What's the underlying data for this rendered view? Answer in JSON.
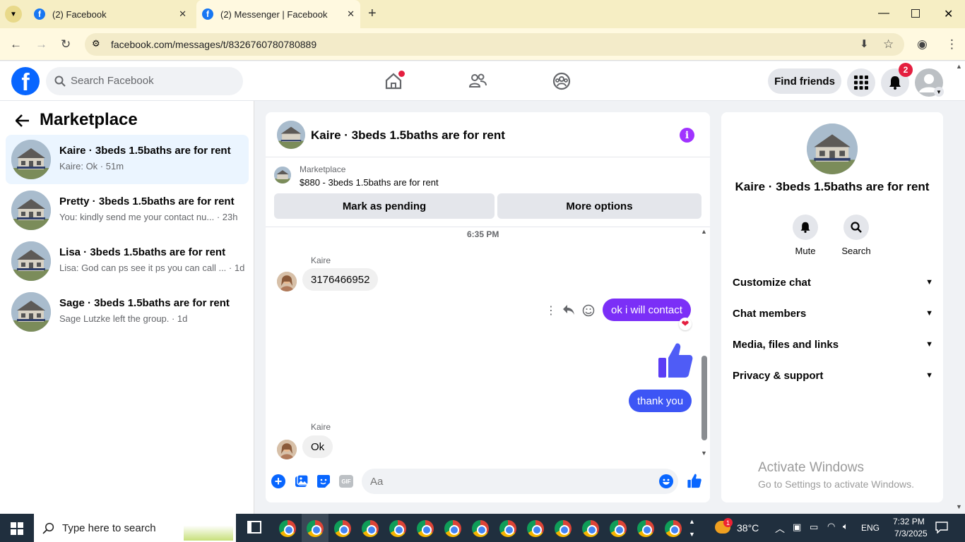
{
  "browser": {
    "tabs": [
      {
        "title": "(2) Facebook"
      },
      {
        "title": "(2) Messenger | Facebook"
      }
    ],
    "url": "facebook.com/messages/t/8326760780780889"
  },
  "fb": {
    "search_placeholder": "Search Facebook",
    "find_friends": "Find friends",
    "notif_count": "2"
  },
  "sidebar": {
    "title": "Marketplace",
    "conversations": [
      {
        "title": "Kaire · 3beds 1.5baths are for rent",
        "snippet": "Kaire: Ok · 51m"
      },
      {
        "title": "Pretty · 3beds 1.5baths are for rent",
        "snippet": "You: kindly send me your contact nu... · 23h"
      },
      {
        "title": "Lisa · 3beds 1.5baths are for rent",
        "snippet": "Lisa: God can ps see it ps you can call ... · 1d"
      },
      {
        "title": "Sage · 3beds 1.5baths are for rent",
        "snippet": "Sage Lutzke left the group. · 1d"
      }
    ]
  },
  "chat": {
    "title": "Kaire · 3beds 1.5baths are for rent",
    "marketplace_label": "Marketplace",
    "listing": "$880 - 3beds 1.5baths are for rent",
    "mark_pending": "Mark as pending",
    "more_options": "More options",
    "timestamp": "6:35 PM",
    "messages": [
      {
        "sender": "Kaire",
        "text": "3176466952"
      },
      {
        "sender": "",
        "text": "ok i will contact"
      },
      {
        "sender": "",
        "text": "thank you"
      },
      {
        "sender": "Kaire",
        "text": "Ok"
      }
    ],
    "input_placeholder": "Aa",
    "accent": "#7b2ff7"
  },
  "right": {
    "title": "Kaire · 3beds 1.5baths are for rent",
    "mute": "Mute",
    "search": "Search",
    "sections": [
      "Customize chat",
      "Chat members",
      "Media, files and links",
      "Privacy & support"
    ]
  },
  "watermark": {
    "line1": "Activate Windows",
    "line2": "Go to Settings to activate Windows."
  },
  "taskbar": {
    "search_placeholder": "Type here to search",
    "temp": "38°C",
    "lang": "ENG",
    "time": "7:32 PM",
    "date": "7/3/2025",
    "weather_badge": "1"
  }
}
